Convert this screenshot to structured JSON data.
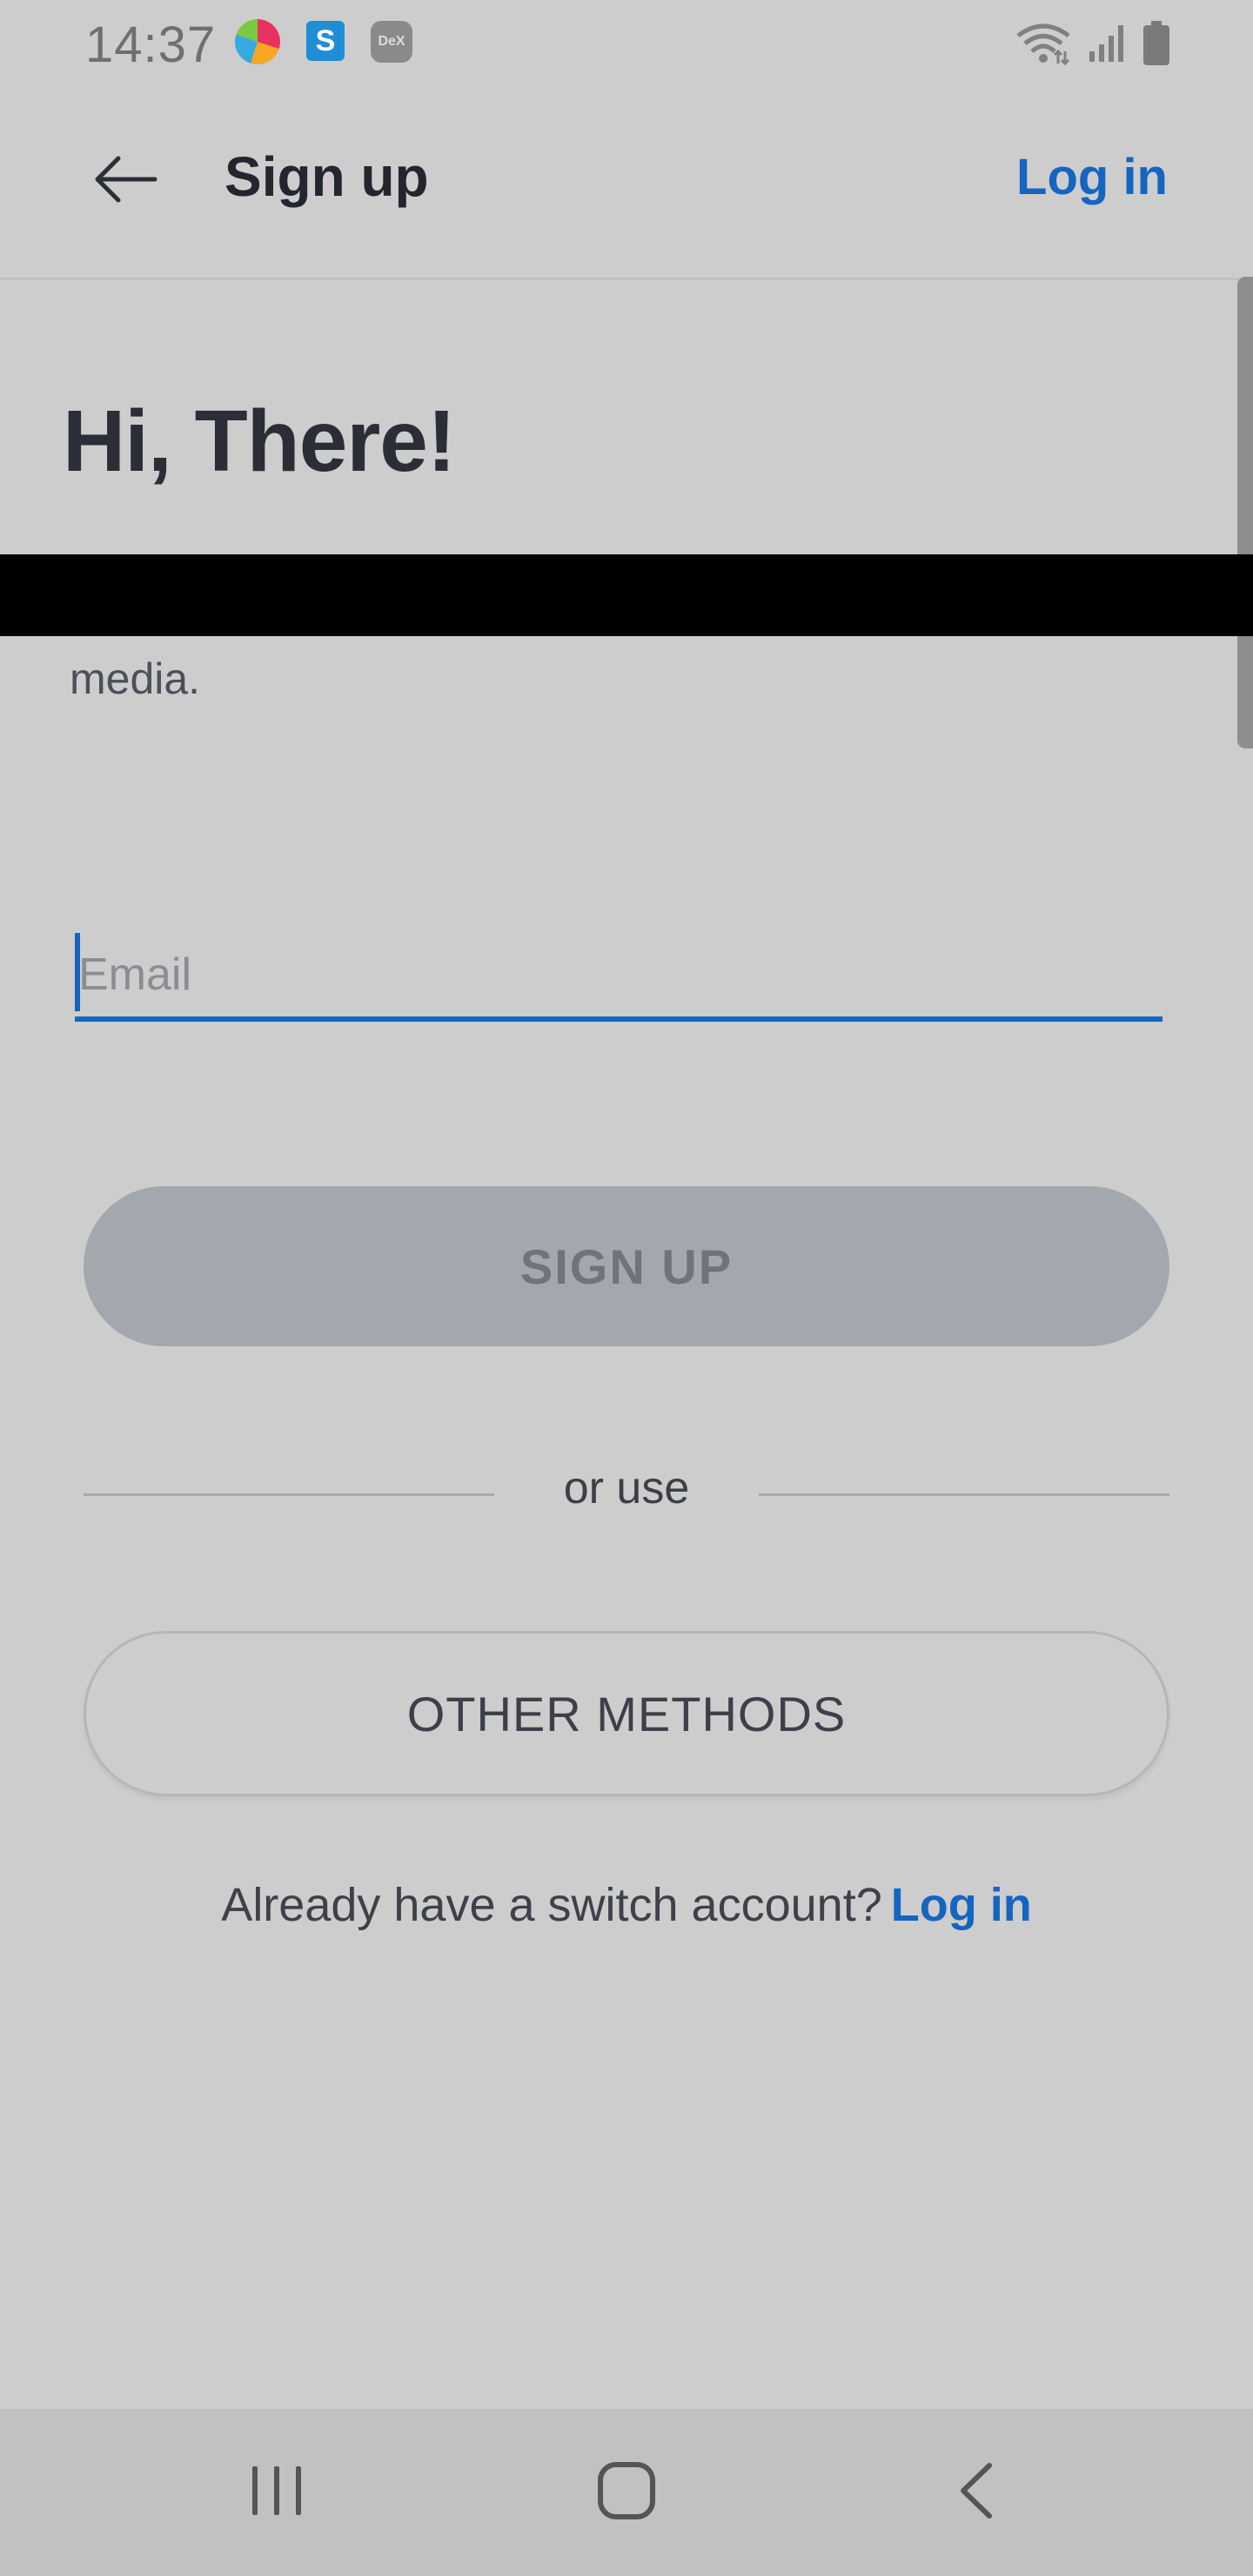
{
  "status_bar": {
    "time": "14:37",
    "dex_label": "DeX",
    "icons": [
      "app-icon-colorful",
      "s-app-icon",
      "dex-icon",
      "wifi-icon",
      "signal-icon",
      "battery-icon"
    ]
  },
  "app_bar": {
    "title": "Sign up",
    "login_link": "Log in",
    "back_icon": "arrow-left-icon"
  },
  "main": {
    "greeting": "Hi, There!",
    "subtitle_visible": "media.",
    "email": {
      "placeholder": "Email",
      "value": ""
    },
    "signup_button": "SIGN UP",
    "divider_text": "or use",
    "other_methods_button": "OTHER METHODS",
    "footer_text": "Already have a switch account?",
    "footer_login": "Log in"
  },
  "nav_bar": {
    "icons": [
      "recents-icon",
      "home-icon",
      "back-icon"
    ]
  },
  "colors": {
    "background": "#cdcdcd",
    "accent": "#1565c0",
    "button_disabled": "#a3a8ae",
    "text_dark": "#2b2e36"
  }
}
